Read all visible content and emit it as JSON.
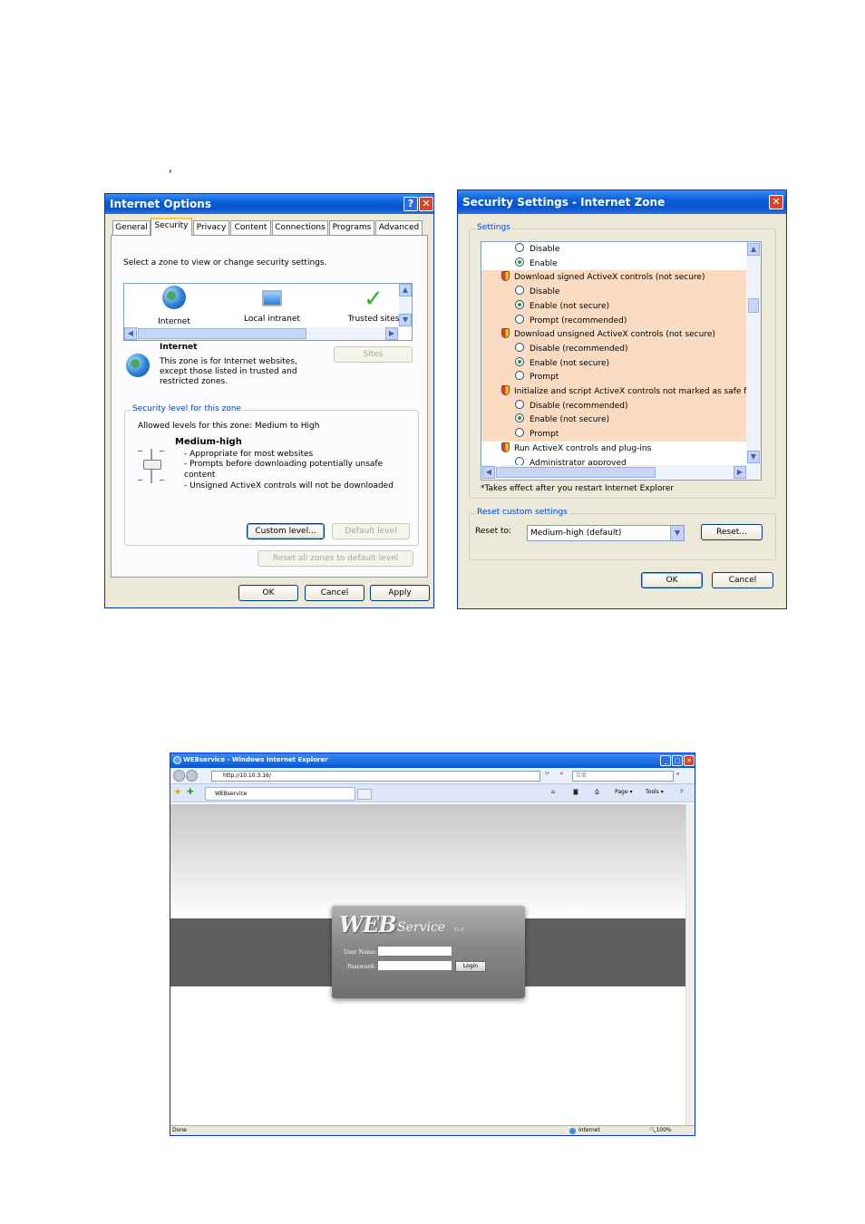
{
  "stray_mark": ",",
  "internet_options": {
    "title": "Internet Options",
    "tabs": [
      "General",
      "Security",
      "Privacy",
      "Content",
      "Connections",
      "Programs",
      "Advanced"
    ],
    "select_zone_text": "Select a zone to view or change security settings.",
    "zones": [
      "Internet",
      "Local intranet",
      "Trusted sites"
    ],
    "zone_heading": "Internet",
    "zone_desc": [
      "This zone is for Internet websites,",
      "except those listed in trusted and",
      "restricted zones."
    ],
    "sites_button": "Sites",
    "security_group_label": "Security level for this zone",
    "allowed_levels": "Allowed levels for this zone: Medium to High",
    "level_name": "Medium-high",
    "level_points": [
      "- Appropriate for most websites",
      "- Prompts before downloading potentially unsafe",
      "content",
      "- Unsigned ActiveX controls will not be downloaded"
    ],
    "custom_level_button": "Custom level...",
    "default_level_button": "Default level",
    "reset_all_button": "Reset all zones to default level",
    "ok_button": "OK",
    "cancel_button": "Cancel",
    "apply_button": "Apply"
  },
  "security_settings": {
    "title": "Security Settings - Internet Zone",
    "settings_label": "Settings",
    "items": [
      {
        "kind": "radio",
        "label": "Disable",
        "checked": false,
        "hl": false
      },
      {
        "kind": "radio",
        "label": "Enable",
        "checked": true,
        "hl": false
      },
      {
        "kind": "header",
        "label": "Download signed ActiveX controls (not secure)",
        "hl": true
      },
      {
        "kind": "radio",
        "label": "Disable",
        "checked": false,
        "hl": true
      },
      {
        "kind": "radio",
        "label": "Enable (not secure)",
        "checked": true,
        "hl": true
      },
      {
        "kind": "radio",
        "label": "Prompt (recommended)",
        "checked": false,
        "hl": true
      },
      {
        "kind": "header",
        "label": "Download unsigned ActiveX controls (not secure)",
        "hl": true
      },
      {
        "kind": "radio",
        "label": "Disable (recommended)",
        "checked": false,
        "hl": true
      },
      {
        "kind": "radio",
        "label": "Enable (not secure)",
        "checked": true,
        "hl": true
      },
      {
        "kind": "radio",
        "label": "Prompt",
        "checked": false,
        "hl": true
      },
      {
        "kind": "header",
        "label": "Initialize and script ActiveX controls not marked as safe for sc",
        "hl": true
      },
      {
        "kind": "radio",
        "label": "Disable (recommended)",
        "checked": false,
        "hl": true
      },
      {
        "kind": "radio",
        "label": "Enable (not secure)",
        "checked": true,
        "hl": true
      },
      {
        "kind": "radio",
        "label": "Prompt",
        "checked": false,
        "hl": true
      },
      {
        "kind": "header",
        "label": "Run ActiveX controls and plug-ins",
        "hl": false
      },
      {
        "kind": "radio",
        "label": "Administrator approved",
        "checked": false,
        "hl": false
      }
    ],
    "restart_note": "*Takes effect after you restart Internet Explorer",
    "reset_group_label": "Reset custom settings",
    "reset_to_label": "Reset to:",
    "reset_to_value": "Medium-high (default)",
    "reset_button": "Reset...",
    "ok_button": "OK",
    "cancel_button": "Cancel"
  },
  "browser": {
    "title": "WEBservice - Windows Internet Explorer",
    "address": "http://10.10.3.16/",
    "search_placeholder": "百度",
    "tab_label": "WEBservice",
    "toolbar_page": "Page",
    "toolbar_tools": "Tools",
    "login": {
      "logo_web": "WEB",
      "logo_service": "Service",
      "logo_version": "V2.0",
      "username_label": "User Name:",
      "password_label": "Password:",
      "login_button": "Login"
    },
    "status_done": "Done",
    "status_zone": "Internet",
    "status_zoom": "100%"
  }
}
